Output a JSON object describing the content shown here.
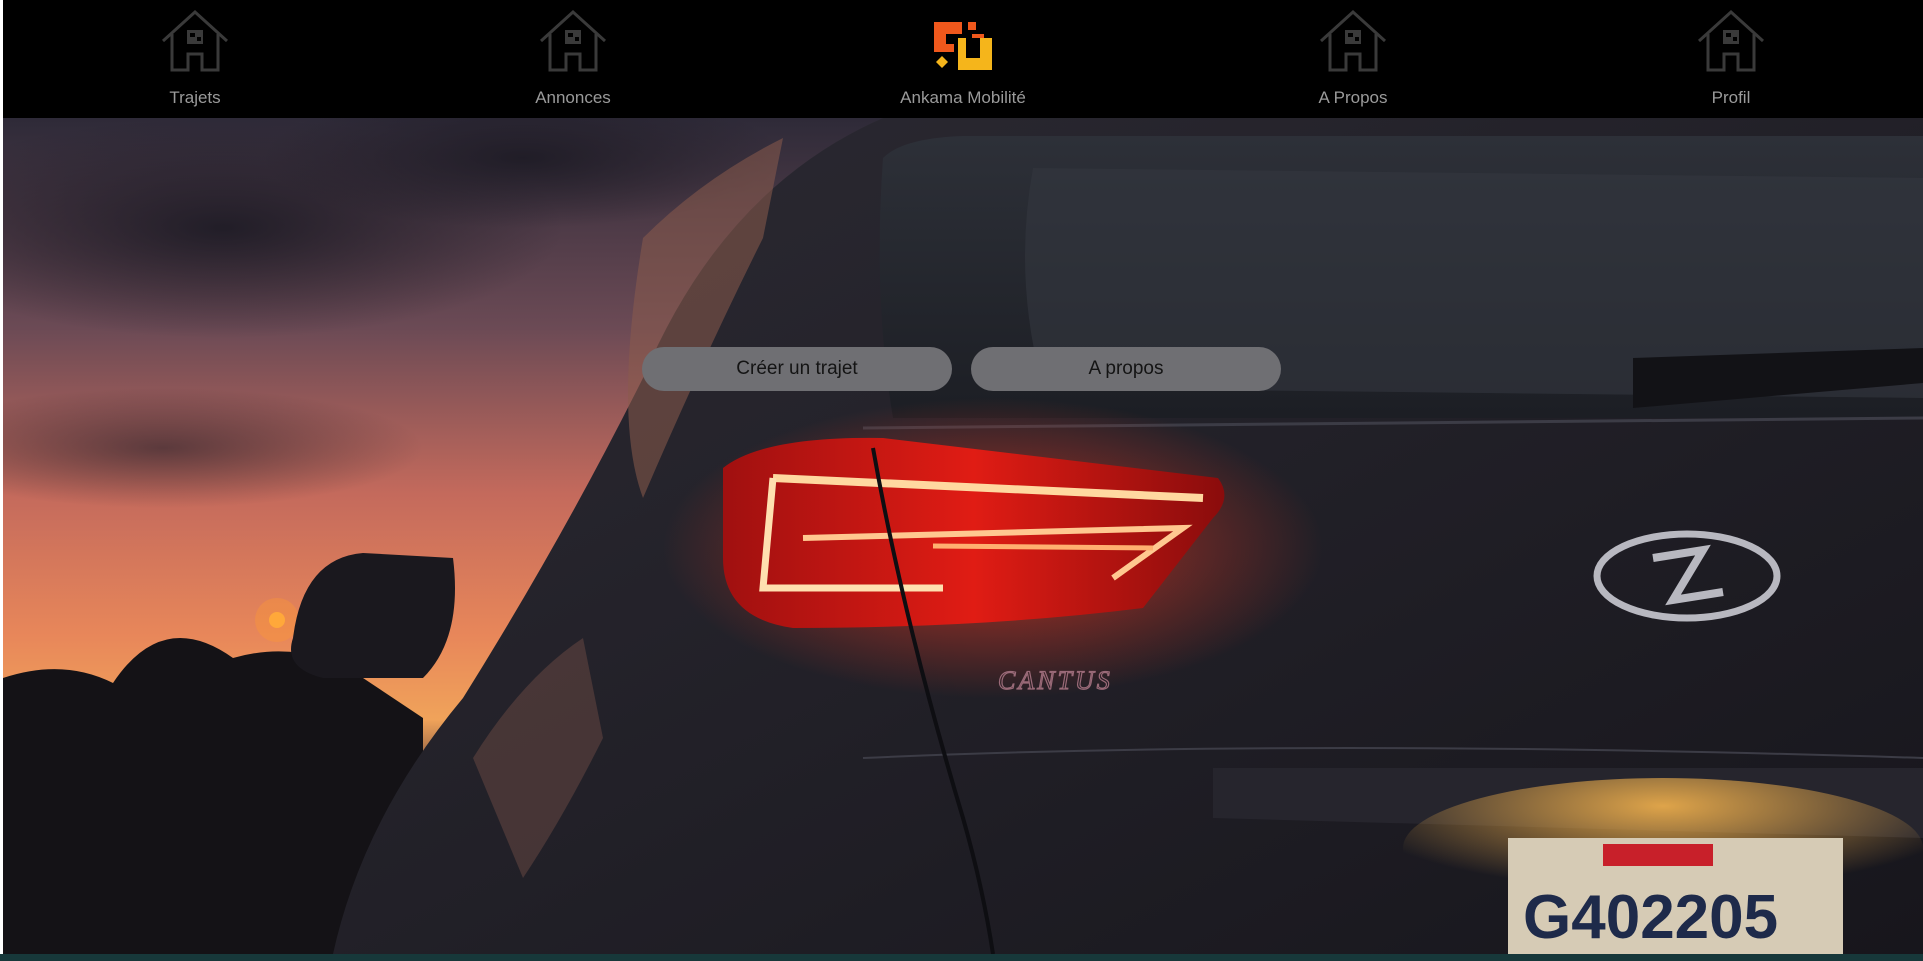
{
  "nav": {
    "items": [
      {
        "label": "Trajets",
        "icon": "home-icon"
      },
      {
        "label": "Annonces",
        "icon": "home-icon"
      },
      {
        "label": "Ankama Mobilité",
        "icon": "ankama-logo"
      },
      {
        "label": "A Propos",
        "icon": "home-icon"
      },
      {
        "label": "Profil",
        "icon": "home-icon"
      }
    ]
  },
  "hero": {
    "image": "car-tail-light-sunset-photo",
    "buttons": {
      "create_trip": "Créer un trajet",
      "about": "A propos"
    }
  },
  "colors": {
    "navbar_bg": "#000000",
    "nav_text": "#9a9a9a",
    "button_bg": "#6f6f73",
    "logo_orange": "#f0581c",
    "logo_yellow": "#f5b51b"
  }
}
